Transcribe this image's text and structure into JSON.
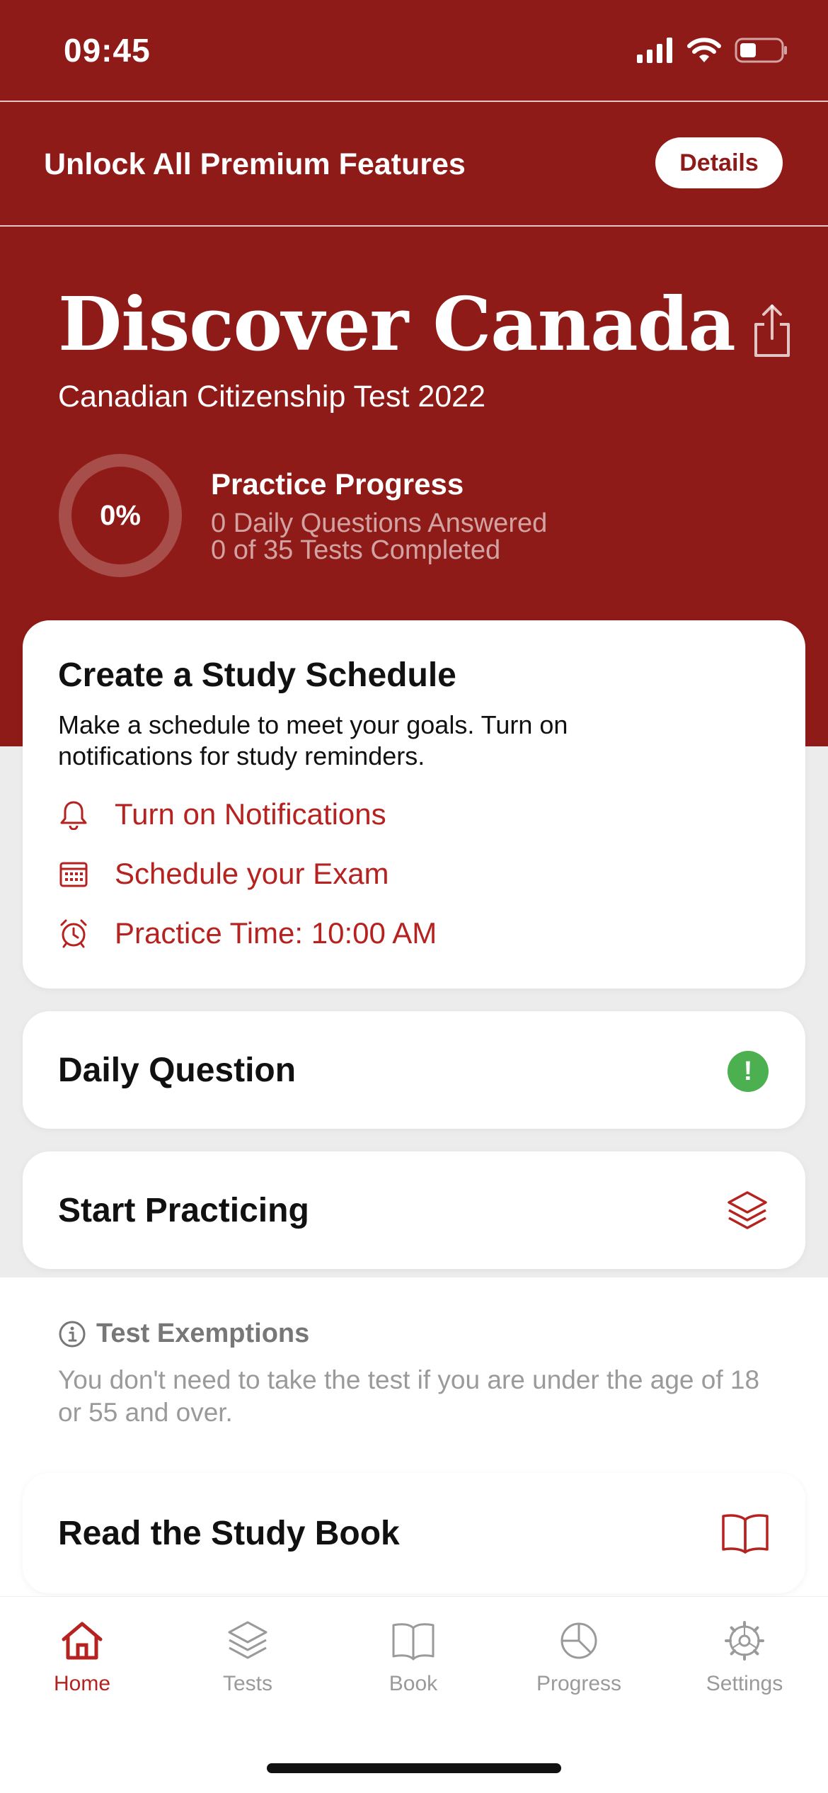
{
  "status_bar": {
    "time": "09:45"
  },
  "promo": {
    "text": "Unlock All Premium Features",
    "button": "Details"
  },
  "hero": {
    "title": "Discover Canada",
    "subtitle": "Canadian Citizenship Test 2022",
    "progress_percent": "0%",
    "progress_value": 0,
    "progress_title": "Practice Progress",
    "progress_line1": "0 Daily Questions Answered",
    "progress_line2": "0 of 35 Tests Completed"
  },
  "schedule": {
    "title": "Create a Study Schedule",
    "description": "Make a schedule to meet your goals. Turn on notifications for study reminders.",
    "actions": [
      {
        "label": "Turn on Notifications",
        "icon": "bell-icon"
      },
      {
        "label": "Schedule your Exam",
        "icon": "calendar-icon"
      },
      {
        "label": "Practice Time: 10:00 AM",
        "icon": "alarm-clock-icon"
      }
    ]
  },
  "daily_question": {
    "label": "Daily Question",
    "badge": "!"
  },
  "start_practicing": {
    "label": "Start Practicing"
  },
  "exemptions": {
    "title": "Test Exemptions",
    "text": "You don't need to take the test if you are under the age of 18 or 55 and over."
  },
  "study_book": {
    "label": "Read the Study Book"
  },
  "tabs": [
    {
      "label": "Home",
      "icon": "home-icon",
      "active": true
    },
    {
      "label": "Tests",
      "icon": "layers-icon",
      "active": false
    },
    {
      "label": "Book",
      "icon": "book-icon",
      "active": false
    },
    {
      "label": "Progress",
      "icon": "pie-chart-icon",
      "active": false
    },
    {
      "label": "Settings",
      "icon": "gear-icon",
      "active": false
    }
  ],
  "colors": {
    "brand": "#8f1b18",
    "accent": "#b5221f",
    "success": "#4caf50",
    "muted": "#9a9a9a"
  }
}
